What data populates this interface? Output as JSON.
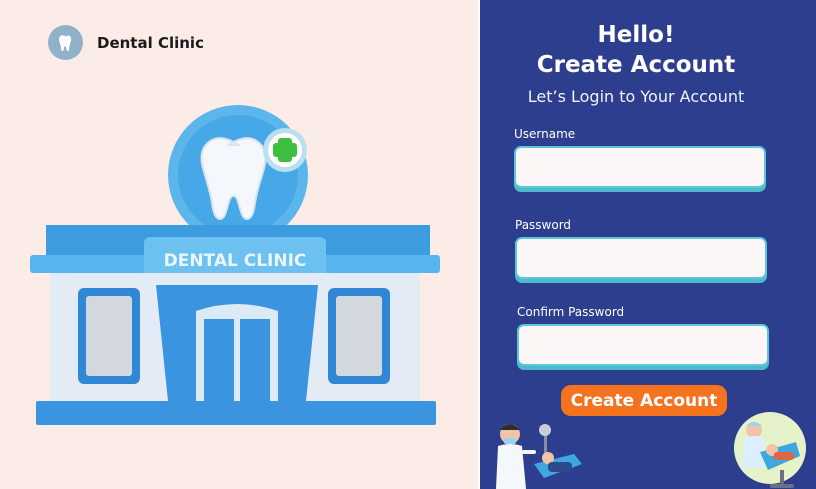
{
  "brand": {
    "name": "Dental Clinic",
    "logo_icon": "tooth-icon"
  },
  "building": {
    "sign": "DENTAL CLINIC"
  },
  "form": {
    "greeting": "Hello!",
    "title": "Create Account",
    "subtitle": "Let’s Login to Your Account",
    "username": {
      "label": "Username",
      "value": ""
    },
    "password": {
      "label": "Password",
      "value": ""
    },
    "confirm_password": {
      "label": "Confirm Password",
      "value": ""
    },
    "submit_label": "Create Account"
  },
  "colors": {
    "left_bg": "#fcece8",
    "right_bg": "#2e3e8e",
    "button": "#f5721f",
    "field_border": "#59c8d9"
  }
}
